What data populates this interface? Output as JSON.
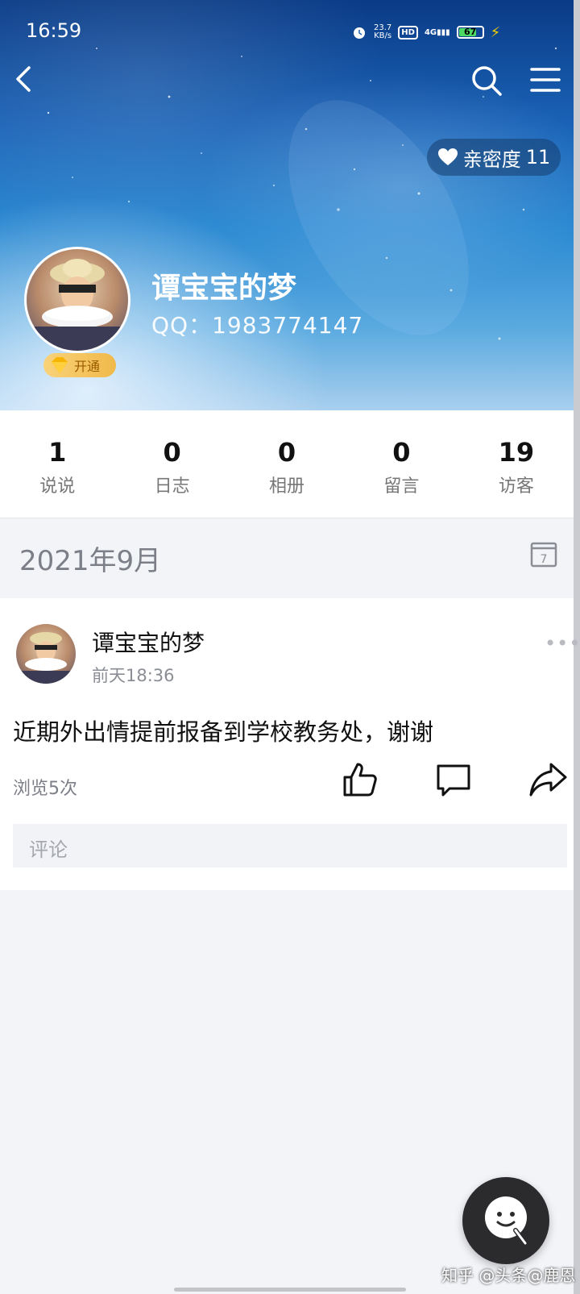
{
  "status_bar": {
    "time": "16:59",
    "net_speed_value": "23.7",
    "net_speed_unit": "KB/s",
    "hd": "HD",
    "network": "4G",
    "battery": "67"
  },
  "header": {
    "back_icon": "chevron-left-icon",
    "search_icon": "search-icon",
    "menu_icon": "hamburger-menu-icon",
    "intimacy_label": "亲密度",
    "intimacy_value": "11"
  },
  "profile": {
    "name": "谭宝宝的梦",
    "qq": "QQ：1983774147",
    "vip_label": "开通"
  },
  "stats": [
    {
      "value": "1",
      "label": "说说"
    },
    {
      "value": "0",
      "label": "日志"
    },
    {
      "value": "0",
      "label": "相册"
    },
    {
      "value": "0",
      "label": "留言"
    },
    {
      "value": "19",
      "label": "访客"
    }
  ],
  "feed": {
    "month": "2021年9月",
    "post": {
      "author": "谭宝宝的梦",
      "time": "前天18:36",
      "text": "近期外出情提前报备到学校教务处，谢谢",
      "views": "浏览5次",
      "comment_placeholder": "评论"
    }
  },
  "watermark": "知乎 @头条@鹿恩",
  "colors": {
    "accent": "#1a62b6",
    "stat_label": "#777777",
    "background": "#f3f4f8"
  }
}
